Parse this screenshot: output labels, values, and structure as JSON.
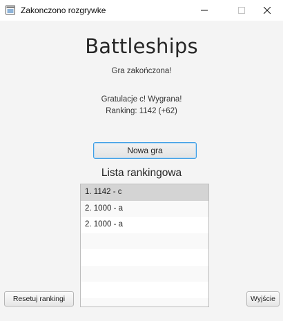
{
  "window": {
    "title": "Zakonczono rozgrywke",
    "icon": "java-window-icon"
  },
  "main": {
    "app_title": "Battleships",
    "status": "Gra zakończona!",
    "result_message": "Gratulacje c! Wygrana!",
    "ranking_line": "Ranking: 1142 (+62)",
    "new_game_label": "Nowa gra",
    "list_title": "Lista rankingowa"
  },
  "ranking_list": {
    "items": [
      "1. 1142 - c",
      "2. 1000 - a",
      "2. 1000 - a"
    ],
    "selected_index": 0
  },
  "footer": {
    "reset_label": "Resetuj rankingi",
    "exit_label": "Wyjście"
  },
  "colors": {
    "background": "#f4f4f4",
    "focus_border": "#3d9ee6",
    "selected_row": "#d4d4d4"
  }
}
